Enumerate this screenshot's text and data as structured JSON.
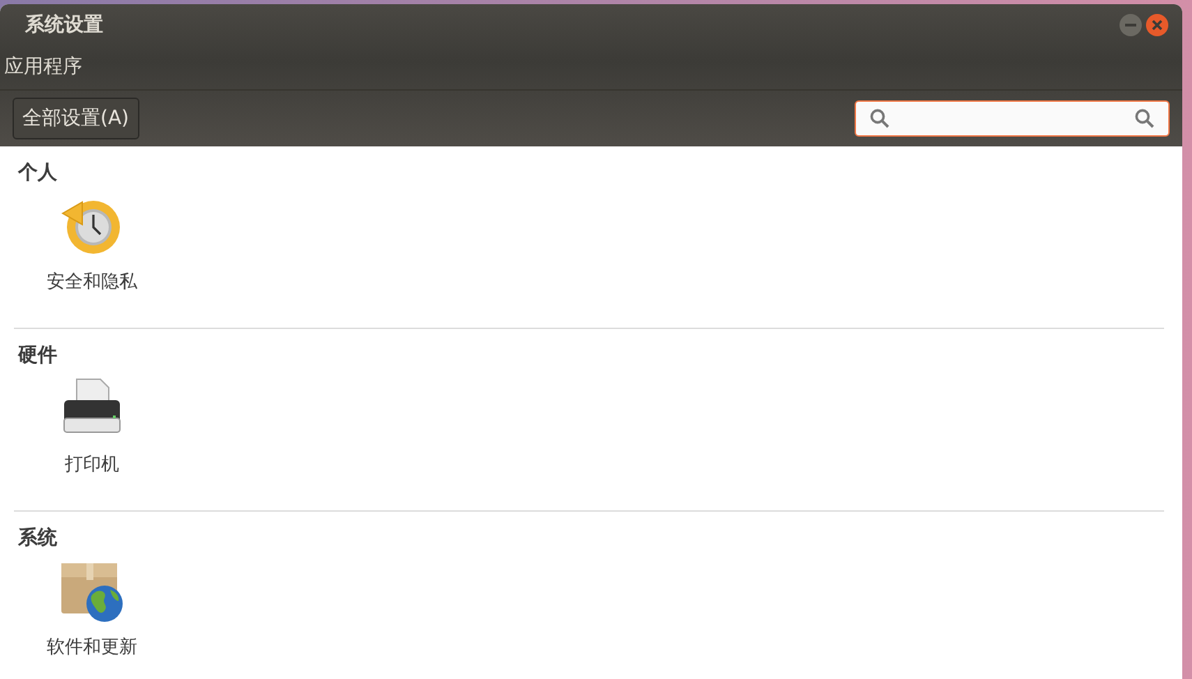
{
  "window": {
    "title": "系统设置"
  },
  "menu": [
    "应用程序"
  ],
  "toolbar": {
    "all_settings": "全部设置(A)"
  },
  "sections": [
    {
      "title": "个人",
      "items": [
        {
          "label": "安全和隐私",
          "kind": "clock"
        }
      ]
    },
    {
      "title": "硬件",
      "items": [
        {
          "label": "打印机",
          "kind": "printer"
        }
      ]
    },
    {
      "title": "系统",
      "items": [
        {
          "label": "软件和更新",
          "kind": "package"
        }
      ]
    }
  ]
}
